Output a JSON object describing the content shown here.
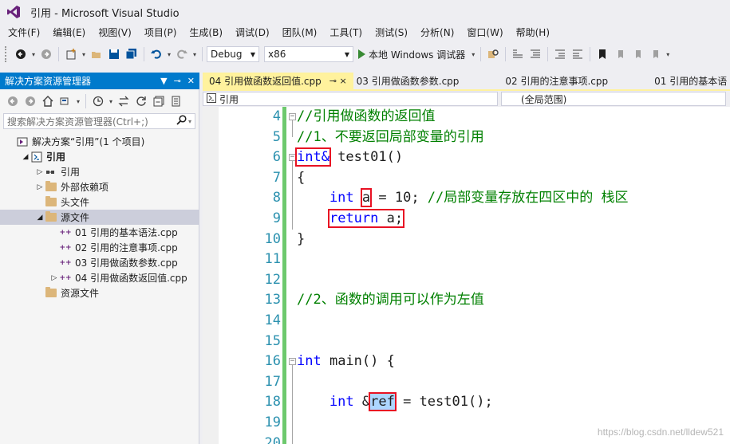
{
  "window": {
    "title": "引用 - Microsoft Visual Studio"
  },
  "menu": [
    "文件(F)",
    "编辑(E)",
    "视图(V)",
    "项目(P)",
    "生成(B)",
    "调试(D)",
    "团队(M)",
    "工具(T)",
    "测试(S)",
    "分析(N)",
    "窗口(W)",
    "帮助(H)"
  ],
  "toolbar": {
    "configuration": "Debug",
    "platform": "x86",
    "run_label": "本地 Windows 调试器"
  },
  "solution_explorer": {
    "title": "解决方案资源管理器",
    "search_placeholder": "搜索解决方案资源管理器(Ctrl+;)",
    "tree": [
      {
        "label": "解决方案“引用”(1 个项目)",
        "indent": 0,
        "icon": "solution-icon",
        "expander": ""
      },
      {
        "label": "引用",
        "indent": 1,
        "icon": "project-icon",
        "expander": "◢",
        "bold": true
      },
      {
        "label": "引用",
        "indent": 2,
        "icon": "references-icon",
        "expander": "▷"
      },
      {
        "label": "外部依赖项",
        "indent": 2,
        "icon": "external-deps-icon",
        "expander": "▷"
      },
      {
        "label": "头文件",
        "indent": 2,
        "icon": "folder-icon",
        "expander": ""
      },
      {
        "label": "源文件",
        "indent": 2,
        "icon": "folder-icon",
        "expander": "◢",
        "selected": true
      },
      {
        "label": "01 引用的基本语法.cpp",
        "indent": 3,
        "icon": "cpp-file-icon",
        "expander": ""
      },
      {
        "label": "02 引用的注意事项.cpp",
        "indent": 3,
        "icon": "cpp-file-icon",
        "expander": ""
      },
      {
        "label": "03 引用做函数参数.cpp",
        "indent": 3,
        "icon": "cpp-file-icon",
        "expander": ""
      },
      {
        "label": "04 引用做函数返回值.cpp",
        "indent": 3,
        "icon": "cpp-file-icon",
        "expander": "▷"
      },
      {
        "label": "资源文件",
        "indent": 2,
        "icon": "folder-icon",
        "expander": ""
      }
    ]
  },
  "tabs": [
    {
      "label": "04 引用做函数返回值.cpp",
      "active": true,
      "pin": "⊸ ×"
    },
    {
      "label": "03 引用做函数参数.cpp",
      "active": false
    },
    {
      "label": "02 引用的注意事项.cpp",
      "active": false
    },
    {
      "label": "01 引用的基本语",
      "active": false
    }
  ],
  "navbar": {
    "scope": "引用",
    "member": "(全局范围)"
  },
  "editor": {
    "line_numbers": [
      "4",
      "5",
      "6",
      "7",
      "8",
      "9",
      "10",
      "11",
      "12",
      "13",
      "14",
      "15",
      "16",
      "17",
      "18",
      "19",
      "20"
    ],
    "lines": [
      [
        {
          "t": "//引用做函数的返回值",
          "c": "cmt"
        }
      ],
      [
        {
          "t": "//1、不要返回局部变量的引用",
          "c": "cmt"
        }
      ],
      [
        {
          "t": "int&",
          "c": "kw",
          "box": true
        },
        {
          "t": " test01()",
          "c": ""
        }
      ],
      [
        {
          "t": "{",
          "c": ""
        }
      ],
      [
        {
          "t": "    int ",
          "c": "kw"
        },
        {
          "t": "a",
          "c": "",
          "box": true
        },
        {
          "t": " = 10; ",
          "c": ""
        },
        {
          "t": "//局部变量存放在四区中的 栈区",
          "c": "cmt"
        }
      ],
      [
        {
          "t": "    ",
          "c": ""
        },
        {
          "t": "return",
          "c": "kw",
          "box": true,
          "group": "ret"
        },
        {
          "t": " a;",
          "c": "",
          "box": true,
          "group": "ret"
        }
      ],
      [
        {
          "t": "}",
          "c": ""
        }
      ],
      [],
      [],
      [
        {
          "t": "//2、函数的调用可以作为左值",
          "c": "cmt"
        }
      ],
      [],
      [],
      [
        {
          "t": "int",
          "c": "kw"
        },
        {
          "t": " main() {",
          "c": ""
        }
      ],
      [],
      [
        {
          "t": "    int ",
          "c": "kw"
        },
        {
          "t": "&",
          "c": ""
        },
        {
          "t": "ref",
          "c": "",
          "box": true,
          "sel": true
        },
        {
          "t": " = test01();",
          "c": ""
        }
      ],
      [],
      []
    ]
  },
  "watermark": "https://blog.csdn.net/lldew521"
}
